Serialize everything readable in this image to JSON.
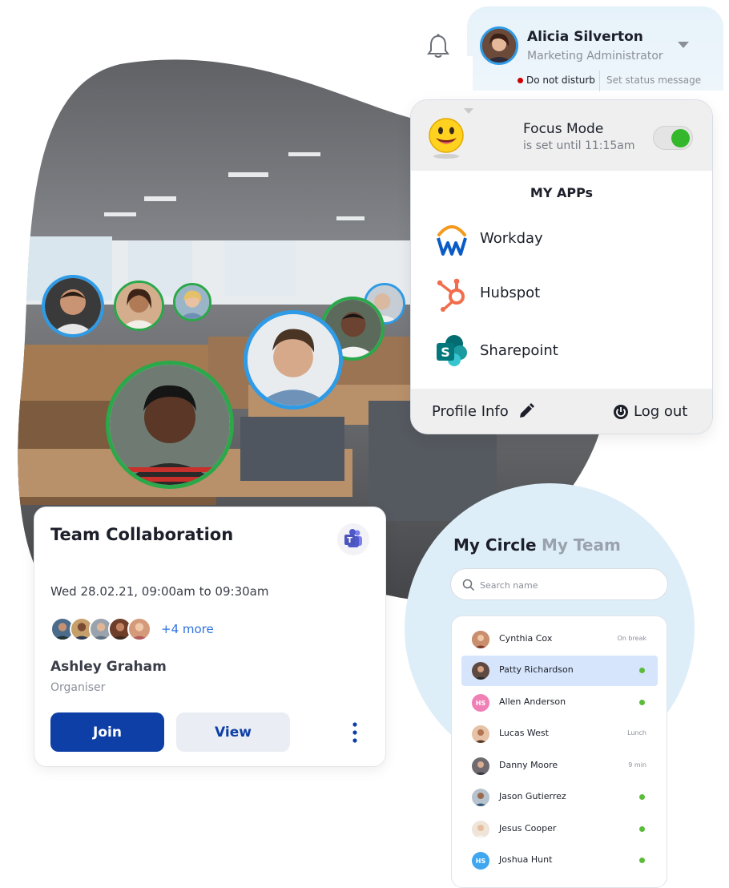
{
  "user": {
    "name": "Alicia Silverton",
    "role": "Marketing Administrator",
    "status": "Do not disturb",
    "status_message_link": "Set status message"
  },
  "focus_mode": {
    "title": "Focus Mode",
    "subtitle": "is set until 11:15am",
    "enabled": true
  },
  "apps": {
    "title": "MY APPs",
    "items": [
      {
        "label": "Workday",
        "icon": "workday-icon"
      },
      {
        "label": "Hubspot",
        "icon": "hubspot-icon"
      },
      {
        "label": "Sharepoint",
        "icon": "sharepoint-icon"
      }
    ],
    "profile_info": "Profile Info",
    "logout": "Log out"
  },
  "meeting": {
    "title": "Team Collaboration",
    "time": "Wed 28.02.21, 09:00am to 09:30am",
    "more_attendees": "+4 more",
    "organiser_name": "Ashley Graham",
    "organiser_label": "Organiser",
    "join_label": "Join",
    "view_label": "View",
    "app_icon": "teams-icon"
  },
  "circle": {
    "tabs": [
      "My Circle",
      "My Team"
    ],
    "active_tab": "My Circle",
    "search_placeholder": "Search name",
    "contacts": [
      {
        "name": "Cynthia Cox",
        "status": "On break"
      },
      {
        "name": "Patty Richardson",
        "status": "online",
        "selected": true
      },
      {
        "name": "Allen Anderson",
        "status": "online",
        "initials": "HS"
      },
      {
        "name": "Lucas West",
        "status": "Lunch"
      },
      {
        "name": "Danny Moore",
        "status": "9 min"
      },
      {
        "name": "Jason Gutierrez",
        "status": "online"
      },
      {
        "name": "Jesus Cooper",
        "status": "online"
      },
      {
        "name": "Joshua Hunt",
        "status": "online",
        "initials": "HS"
      }
    ]
  },
  "colors": {
    "primary": "#0d3fa6",
    "online": "#5dbb3a",
    "dnd": "#cc0000",
    "green_ring": "#2aa84a",
    "blue_ring": "#2f9be6"
  }
}
